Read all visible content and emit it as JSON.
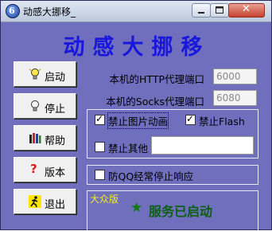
{
  "window": {
    "title": "动感大挪移_",
    "close_glyph": "✕"
  },
  "app": {
    "heading": "动感大挪移"
  },
  "buttons": [
    {
      "id": "start",
      "label": "启动",
      "icon": "lightbulb-lit-icon"
    },
    {
      "id": "stop",
      "label": "停止",
      "icon": "lightbulb-off-icon"
    },
    {
      "id": "help",
      "label": "帮助",
      "icon": "books-icon"
    },
    {
      "id": "version",
      "label": "版本",
      "icon": "question-icon"
    },
    {
      "id": "exit",
      "label": "退出",
      "icon": "running-man-icon"
    }
  ],
  "ports": {
    "http_label": "本机的HTTP代理端口",
    "http_value": "6000",
    "socks_label": "本机的Socks代理端口",
    "socks_value": "6080"
  },
  "options": {
    "block_image_anim": {
      "label": "禁止图片动画",
      "checked": true
    },
    "block_flash": {
      "label": "禁止Flash",
      "checked": true
    },
    "block_other": {
      "label": "禁止其他",
      "checked": false,
      "value": ""
    },
    "qq_keepalive": {
      "label": "防QQ经常停止响应",
      "checked": false
    }
  },
  "status": {
    "edition": "大众版",
    "star": "★",
    "text": "服务已启动"
  },
  "colors": {
    "background": "#6f6fbd",
    "heading": "#1a17dc",
    "status": "#0e5e12",
    "edition": "#f2ea2a"
  }
}
